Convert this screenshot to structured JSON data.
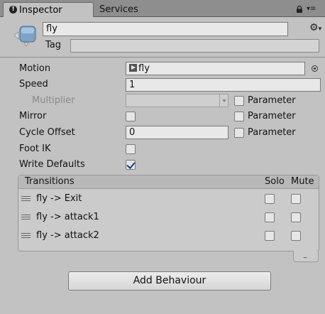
{
  "tabs": [
    {
      "label": "Inspector",
      "icon": "info-icon",
      "active": true
    },
    {
      "label": "Services",
      "active": false
    }
  ],
  "header": {
    "state_name": "fly",
    "tag_label": "Tag",
    "tag_value": ""
  },
  "properties": {
    "motion": {
      "label": "Motion",
      "value": "fly"
    },
    "speed": {
      "label": "Speed",
      "value": "1"
    },
    "multiplier": {
      "label": "Multiplier",
      "value": ""
    },
    "mirror": {
      "label": "Mirror",
      "checked": false
    },
    "cycle_offset": {
      "label": "Cycle Offset",
      "value": "0"
    },
    "foot_ik": {
      "label": "Foot IK",
      "checked": false
    },
    "write_defaults": {
      "label": "Write Defaults",
      "checked": true
    },
    "parameter_label": "Parameter"
  },
  "transitions": {
    "header": "Transitions",
    "solo_label": "Solo",
    "mute_label": "Mute",
    "rows": [
      {
        "label": "fly -> Exit",
        "solo": false,
        "mute": false
      },
      {
        "label": "fly -> attack1",
        "solo": false,
        "mute": false
      },
      {
        "label": "fly -> attack2",
        "solo": false,
        "mute": false
      }
    ],
    "remove_label": "–"
  },
  "add_behaviour_label": "Add Behaviour"
}
